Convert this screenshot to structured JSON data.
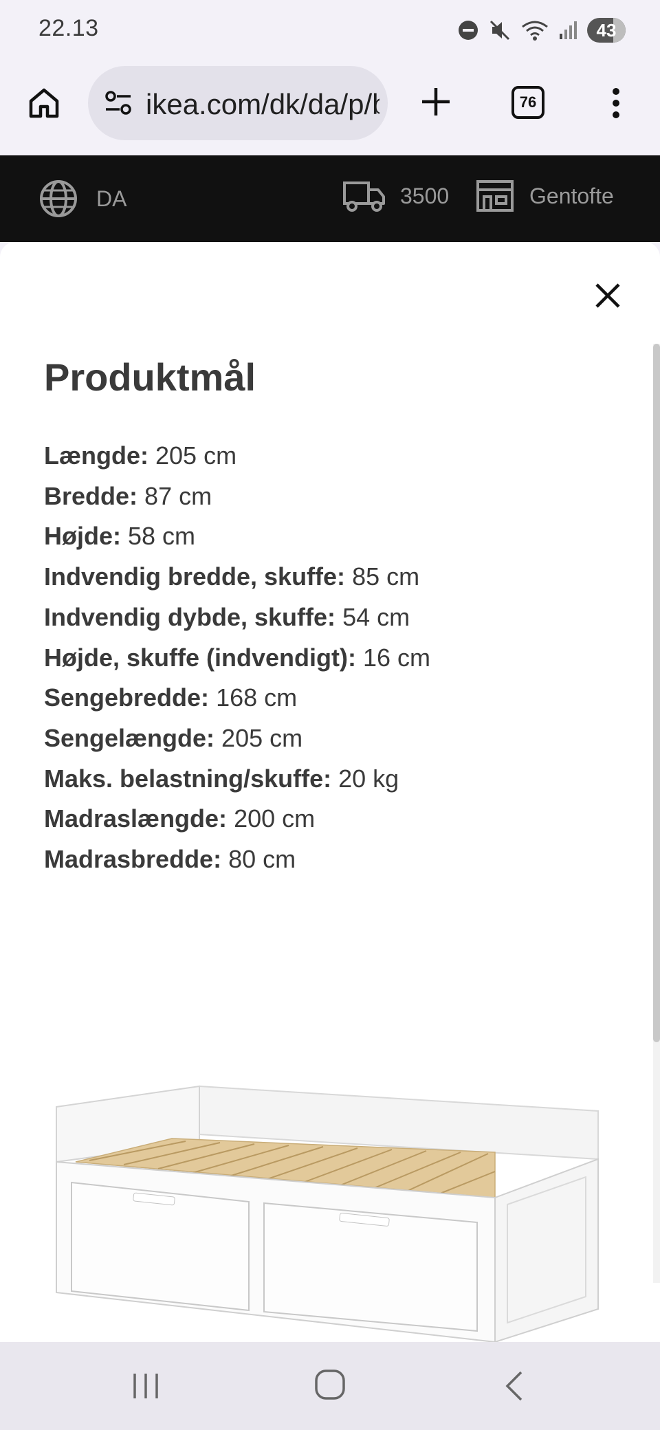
{
  "status_bar": {
    "time": "22.13",
    "battery": "43"
  },
  "browser": {
    "url": "ikea.com/dk/da/p/brimnes-daybed",
    "tab_count": "76"
  },
  "header": {
    "language": "DA",
    "postal_code": "3500",
    "store": "Gentofte"
  },
  "modal": {
    "title": "Produktmål",
    "dimensions": [
      {
        "label": "Længde:",
        "value": "205 cm"
      },
      {
        "label": "Bredde:",
        "value": "87 cm"
      },
      {
        "label": "Højde:",
        "value": "58 cm"
      },
      {
        "label": "Indvendig bredde, skuffe:",
        "value": "85 cm"
      },
      {
        "label": "Indvendig dybde, skuffe:",
        "value": "54 cm"
      },
      {
        "label": "Højde, skuffe (indvendigt):",
        "value": "16 cm"
      },
      {
        "label": "Sengebredde:",
        "value": "168 cm"
      },
      {
        "label": "Sengelængde:",
        "value": "205 cm"
      },
      {
        "label": "Maks. belastning/skuffe:",
        "value": "20 kg"
      },
      {
        "label": "Madraslængde:",
        "value": "200 cm"
      },
      {
        "label": "Madrasbredde:",
        "value": "80 cm"
      }
    ]
  },
  "icons": {
    "home": "home-icon",
    "site_settings": "tune-icon",
    "new_tab": "plus-icon",
    "menu": "more-vert-icon",
    "language": "globe-icon",
    "delivery": "truck-icon",
    "store": "store-icon",
    "close": "close-icon"
  },
  "colors": {
    "header_bg": "#111111",
    "header_text": "#9a9a9a",
    "modal_bg": "#ffffff",
    "text": "#3a3a3a",
    "slats": "#e2c99a"
  }
}
